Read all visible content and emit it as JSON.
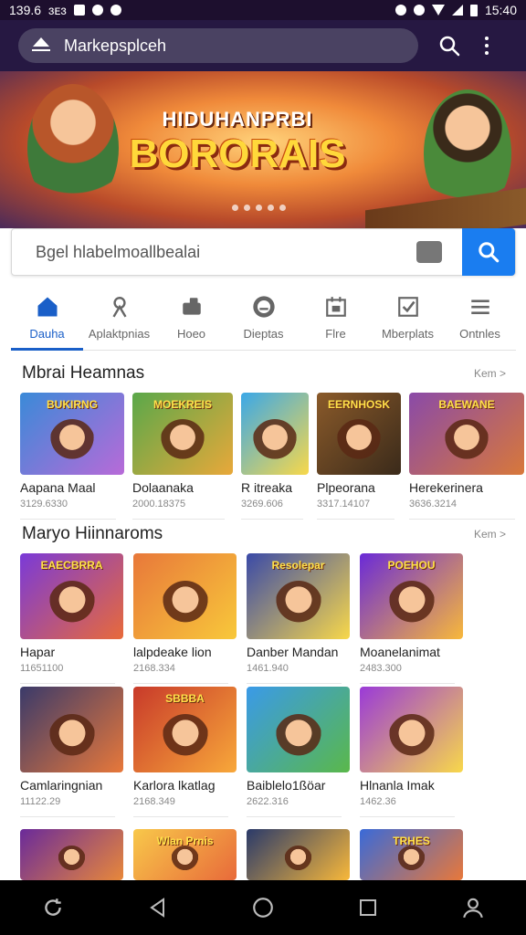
{
  "status": {
    "time_left": "139.6",
    "carrier": "ɜᴇɜ",
    "time_right": "15:40"
  },
  "browser": {
    "url": "Markepsplceh"
  },
  "hero": {
    "title_line1": "HIDUHANPRBI",
    "title_line2": "BORORAIS"
  },
  "search": {
    "placeholder": "Bgel hlabelmoallbealai"
  },
  "tabs": [
    {
      "label": "Dauha",
      "icon": "home-icon",
      "active": true
    },
    {
      "label": "Aplaktpnias",
      "icon": "apps-icon",
      "active": false
    },
    {
      "label": "Hoeo",
      "icon": "games-icon",
      "active": false
    },
    {
      "label": "Dieptas",
      "icon": "chat-icon",
      "active": false
    },
    {
      "label": "Flre",
      "icon": "calendar-icon",
      "active": false
    },
    {
      "label": "Mberplats",
      "icon": "checkbox-icon",
      "active": false
    },
    {
      "label": "Ontnles",
      "icon": "menu-icon",
      "active": false
    }
  ],
  "section1": {
    "title": "Mbrai Heamnas",
    "more": "Kem >",
    "items": [
      {
        "name": "Aapana Maal",
        "meta": "3129.6330",
        "title_text": "BUKIRNG",
        "bg1": "#3a8ad8",
        "bg2": "#b86ad8"
      },
      {
        "name": "Dolaanaka",
        "meta": "2000.18375",
        "title_text": "MOEKREIS",
        "bg1": "#5aa84a",
        "bg2": "#e8a83a"
      },
      {
        "name": "R itreaka",
        "meta": "3269.606",
        "title_text": "",
        "bg1": "#3aa8e8",
        "bg2": "#f8d84a"
      },
      {
        "name": "Plpeorana",
        "meta": "3317.14107",
        "title_text": "EERNHOSK",
        "bg1": "#8a5a2a",
        "bg2": "#3a2a1a"
      },
      {
        "name": "Herekerinera",
        "meta": "3636.3214",
        "title_text": "BAEWANE",
        "bg1": "#8a4aa8",
        "bg2": "#d8783a"
      }
    ]
  },
  "section2": {
    "title": "Maryo Hiinnaroms",
    "more": "Kem >",
    "items": [
      {
        "name": "Hapar",
        "meta": "11651100",
        "title_text": "EAECBRRA",
        "bg1": "#7a3ad8",
        "bg2": "#e86a3a"
      },
      {
        "name": "lalpdeake lion",
        "meta": "2168.334",
        "title_text": "",
        "bg1": "#e8783a",
        "bg2": "#f8c83a"
      },
      {
        "name": "Danber Mandan",
        "meta": "1461.940",
        "title_text": "Resolepar",
        "bg1": "#3a4aa8",
        "bg2": "#f8d84a"
      },
      {
        "name": "Moanelanimat",
        "meta": "2483.300",
        "title_text": "POEHOU",
        "bg1": "#6a2ad8",
        "bg2": "#f8b83a"
      },
      {
        "name": "Camlaringnian",
        "meta": "11122.29",
        "title_text": "",
        "bg1": "#3a3a6a",
        "bg2": "#e8783a"
      },
      {
        "name": "Karlora lkatlag",
        "meta": "2168.349",
        "title_text": "SBBBA",
        "bg1": "#c83a2a",
        "bg2": "#f8a83a"
      },
      {
        "name": "Baiblelo1ßöar",
        "meta": "2622.316",
        "title_text": "",
        "bg1": "#3a9ae8",
        "bg2": "#5ab84a"
      },
      {
        "name": "Hlnanla Imak",
        "meta": "1462.36",
        "title_text": "",
        "bg1": "#9a3ad8",
        "bg2": "#f8d84a"
      }
    ],
    "partial": [
      {
        "title_text": "",
        "bg1": "#6a2a9a",
        "bg2": "#e8883a"
      },
      {
        "title_text": "Wlan Prnis",
        "bg1": "#f8c84a",
        "bg2": "#e86a3a"
      },
      {
        "title_text": "",
        "bg1": "#2a3a6a",
        "bg2": "#f8b83a"
      },
      {
        "title_text": "TRHES",
        "bg1": "#3a6ad8",
        "bg2": "#e8783a"
      }
    ]
  }
}
